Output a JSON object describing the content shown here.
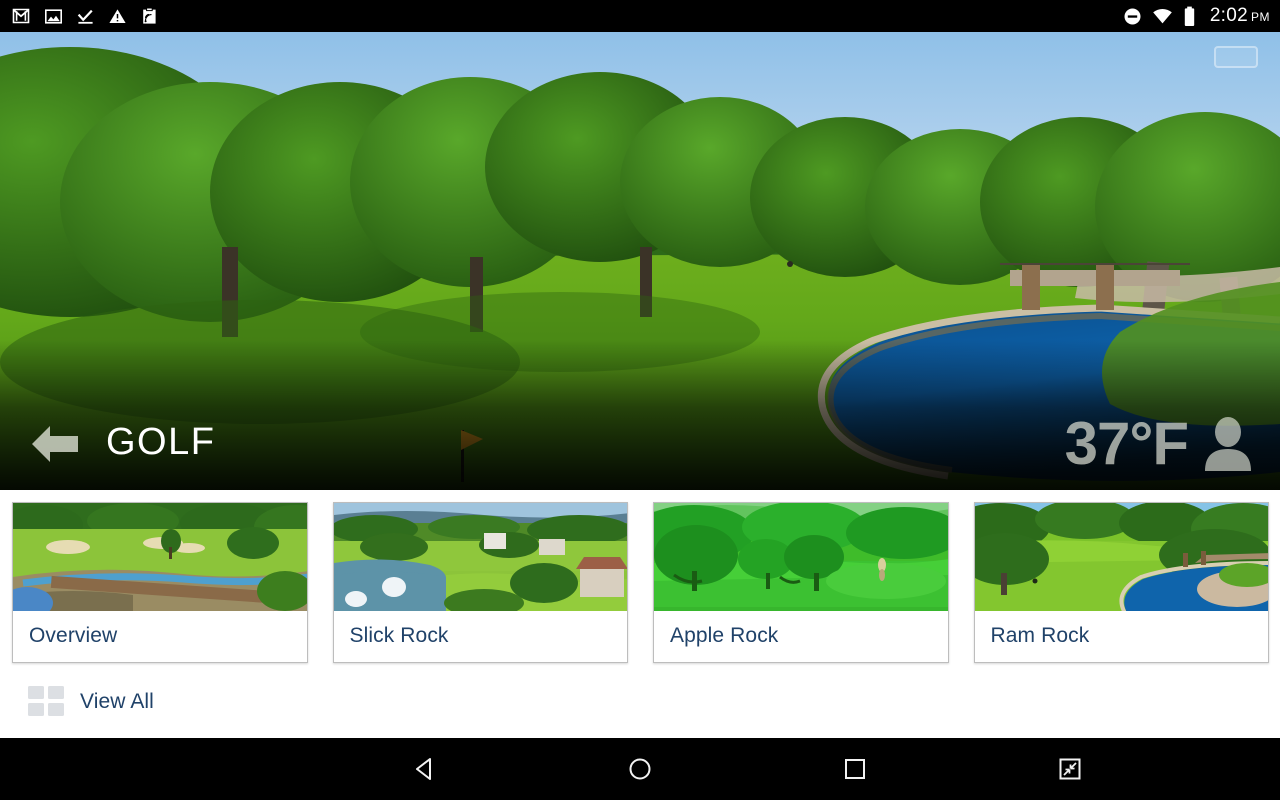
{
  "statusbar": {
    "left_icons": [
      {
        "name": "mail-icon",
        "label": "Mail"
      },
      {
        "name": "image-icon",
        "label": "Screenshot"
      },
      {
        "name": "check-icon",
        "label": "Download complete"
      },
      {
        "name": "warning-icon",
        "label": "Warning"
      },
      {
        "name": "clipboard-icon",
        "label": "Clipboard"
      }
    ],
    "right_icons": [
      {
        "name": "do-not-disturb-icon",
        "label": "Do not disturb"
      },
      {
        "name": "wifi-icon",
        "label": "Wi-Fi"
      },
      {
        "name": "battery-icon",
        "label": "Battery full"
      }
    ],
    "time": "2:02",
    "meridiem": "PM"
  },
  "hero": {
    "title": "GOLF",
    "temperature": "37°F",
    "back_icon": "back-arrow-icon",
    "account_icon": "person-icon",
    "top_button_icon": "cast-button-icon",
    "image_alt": "Golf course fairway with pond and trees"
  },
  "cards": [
    {
      "label": "Overview",
      "image_alt": "Aerial view of golf course with stone bridge over creek"
    },
    {
      "label": "Slick Rock",
      "image_alt": "Golf course with lake fountains and clubhouse"
    },
    {
      "label": "Apple Rock",
      "image_alt": "Lush green trees along a fairway"
    },
    {
      "label": "Ram Rock",
      "image_alt": "Fairway beside a blue pond lined with trees"
    }
  ],
  "view_all": {
    "label": "View All",
    "icon": "grid-icon"
  },
  "navbar": {
    "back_label": "Back",
    "home_label": "Home",
    "recents_label": "Recents",
    "shrink_label": "Shrink screen"
  },
  "colors": {
    "link_navy": "#204269",
    "status_bg": "#000000",
    "page_bg": "#ffffff",
    "card_border": "#bdbdbd"
  }
}
